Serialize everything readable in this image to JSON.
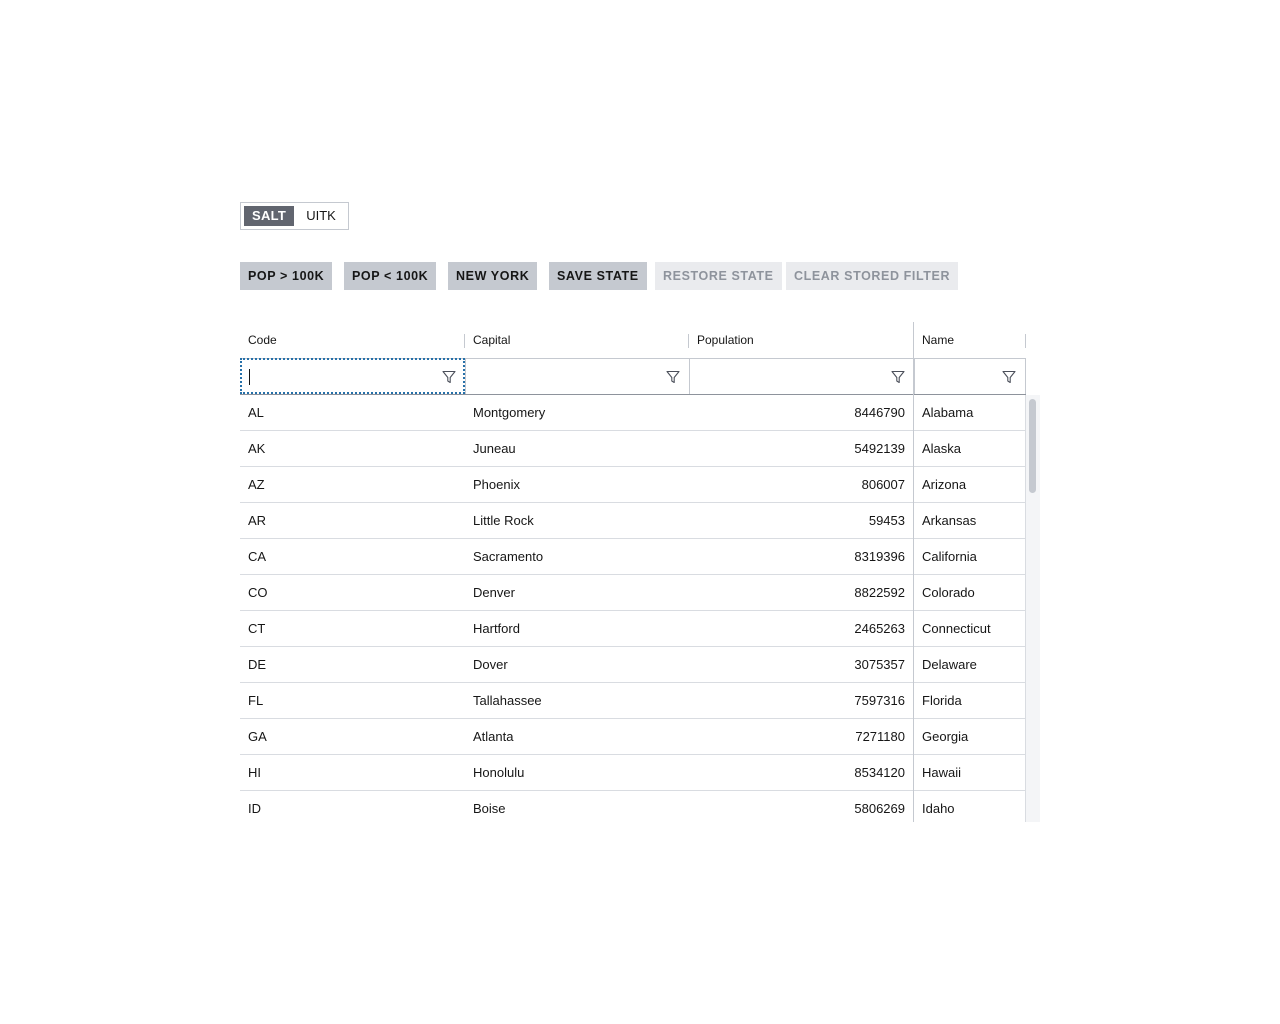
{
  "theme_toggle": {
    "options": [
      "SALT",
      "UITK"
    ],
    "selected": "SALT"
  },
  "toolbar": {
    "buttons": [
      {
        "label": "POP > 100K",
        "disabled": false
      },
      {
        "label": "POP < 100K",
        "disabled": false
      },
      {
        "label": "NEW YORK",
        "disabled": false
      },
      {
        "label": "SAVE STATE",
        "disabled": false
      },
      {
        "label": "RESTORE STATE",
        "disabled": true
      },
      {
        "label": "CLEAR STORED FILTER",
        "disabled": true
      }
    ]
  },
  "grid": {
    "columns": [
      "Code",
      "Capital",
      "Population",
      "Name"
    ],
    "filters": [
      "",
      "",
      "",
      ""
    ],
    "rows": [
      [
        "AL",
        "Montgomery",
        "8446790",
        "Alabama"
      ],
      [
        "AK",
        "Juneau",
        "5492139",
        "Alaska"
      ],
      [
        "AZ",
        "Phoenix",
        "806007",
        "Arizona"
      ],
      [
        "AR",
        "Little Rock",
        "59453",
        "Arkansas"
      ],
      [
        "CA",
        "Sacramento",
        "8319396",
        "California"
      ],
      [
        "CO",
        "Denver",
        "8822592",
        "Colorado"
      ],
      [
        "CT",
        "Hartford",
        "2465263",
        "Connecticut"
      ],
      [
        "DE",
        "Dover",
        "3075357",
        "Delaware"
      ],
      [
        "FL",
        "Tallahassee",
        "7597316",
        "Florida"
      ],
      [
        "GA",
        "Atlanta",
        "7271180",
        "Georgia"
      ],
      [
        "HI",
        "Honolulu",
        "8534120",
        "Hawaii"
      ],
      [
        "ID",
        "Boise",
        "5806269",
        "Idaho"
      ]
    ]
  },
  "colors": {
    "selected_toggle_bg": "#61656f",
    "button_bg": "#c5c9d0",
    "button_disabled_bg": "#eaebee",
    "focus_outline": "#2670a9"
  }
}
